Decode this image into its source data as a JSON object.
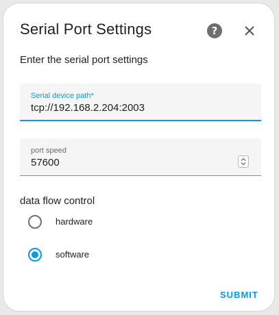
{
  "dialog": {
    "title": "Serial Port Settings",
    "help_icon": "help-circle-icon",
    "help_glyph": "?",
    "close_icon": "close-icon",
    "subtitle": "Enter the serial port settings"
  },
  "fields": {
    "path": {
      "label": "Serial device path*",
      "value": "tcp://192.168.2.204:2003"
    },
    "speed": {
      "label": "port speed",
      "value": "57600",
      "stepper_icon": "up-down-stepper-icon"
    }
  },
  "flow_control": {
    "label": "data flow control",
    "options": [
      {
        "label": "hardware",
        "checked": false
      },
      {
        "label": "software",
        "checked": true
      }
    ]
  },
  "actions": {
    "submit_label": "SUBMIT"
  },
  "colors": {
    "accent": "#039be5",
    "text": "#212121",
    "field_bg": "#f5f5f5",
    "icon": "#6f6f6f"
  }
}
